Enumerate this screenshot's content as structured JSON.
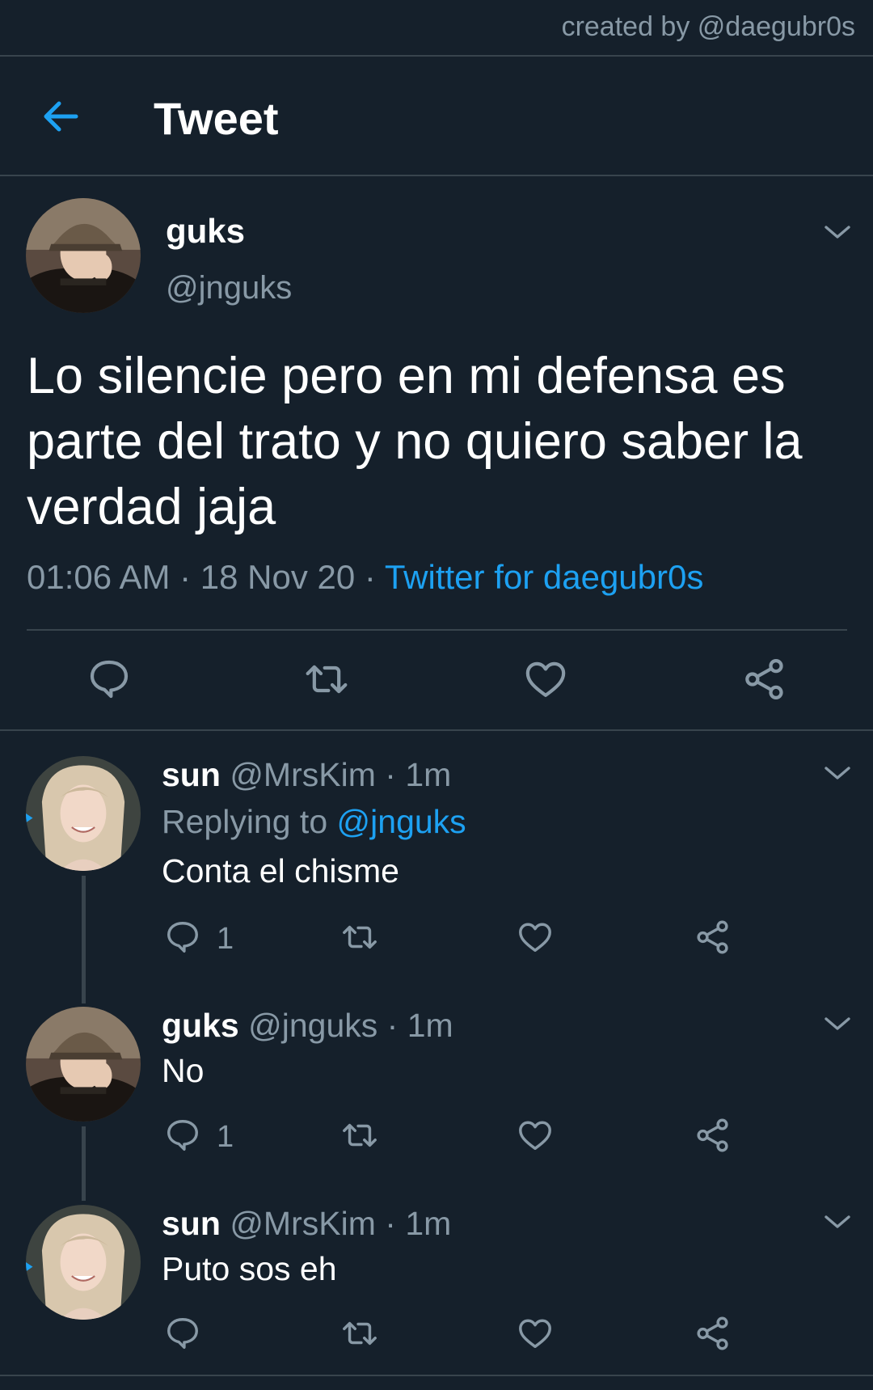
{
  "credit": "created by @daegubr0s",
  "header": {
    "title": "Tweet"
  },
  "main_tweet": {
    "name": "guks",
    "handle": "@jnguks",
    "text": "Lo silencie pero en mi defensa es parte del trato y no quiero saber la verdad jaja",
    "time": "01:06 AM",
    "date": "18 Nov 20",
    "source": "Twitter for daegubr0s"
  },
  "replies": [
    {
      "name": "sun",
      "handle": "@MrsKim",
      "age": "1m",
      "replying_prefix": "Replying to",
      "replying_to": "@jnguks",
      "text": "Conta el chisme",
      "reply_count": "1"
    },
    {
      "name": "guks",
      "handle": "@jnguks",
      "age": "1m",
      "text": "No",
      "reply_count": "1"
    },
    {
      "name": "sun",
      "handle": "@MrsKim",
      "age": "1m",
      "text": "Puto sos eh"
    }
  ],
  "icons": [
    "back-arrow-icon",
    "chevron-down-icon",
    "reply-icon",
    "retweet-icon",
    "like-icon",
    "share-icon"
  ],
  "colors": {
    "background": "#15202b",
    "accent": "#1da1f2",
    "muted": "#8899a6",
    "divider": "#38444d"
  }
}
